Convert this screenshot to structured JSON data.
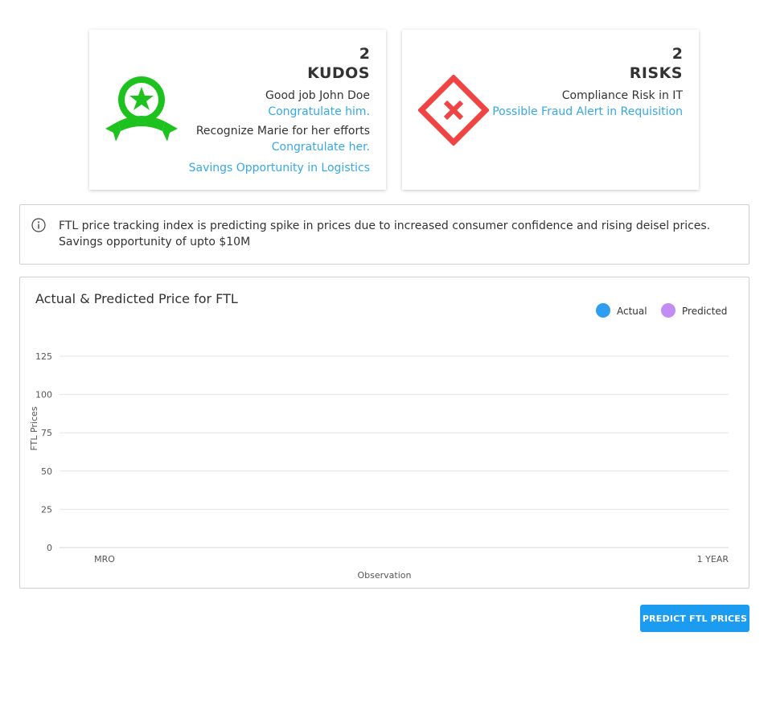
{
  "kudos": {
    "count": "2",
    "title": "KUDOS",
    "icon": "ribbon-star-icon",
    "items": [
      {
        "text": "Good job John Doe",
        "link": "Congratulate him."
      },
      {
        "text": "Recognize Marie for her efforts",
        "link": "Congratulate her."
      }
    ],
    "footer_link": "Savings Opportunity in Logistics"
  },
  "risks": {
    "count": "2",
    "title": "RISKS",
    "icon": "diamond-x-icon",
    "items": [
      {
        "text": "Compliance Risk in IT"
      },
      {
        "link": "Possible Fraud Alert in Requisition"
      }
    ]
  },
  "info": {
    "icon": "info-icon",
    "text_line1": "FTL price tracking index is predicting spike in prices due to increased consumer confidence and rising deisel prices.",
    "text_line2": "Savings opportunity of upto $10M"
  },
  "chart_data": {
    "type": "line",
    "title": "Actual & Predicted Price for FTL",
    "xlabel": "Observation",
    "ylabel": "FTL Prices",
    "categories": [
      "MRO",
      "1 YEAR"
    ],
    "y_ticks": [
      "125",
      "100",
      "75",
      "50",
      "25",
      "0"
    ],
    "ylim": [
      0,
      125
    ],
    "grid": true,
    "legend_position": "top-right",
    "series": [
      {
        "name": "Actual",
        "color": "#2f9df0",
        "values": []
      },
      {
        "name": "Predicted",
        "color": "#c38cf2",
        "values": []
      }
    ]
  },
  "colors": {
    "kudos_green": "#1ec21e",
    "risk_red": "#f04343",
    "link_blue": "#35a9e6",
    "button_blue": "#1c9cf0"
  },
  "actions": {
    "predict_label": "PREDICT FTL PRICES"
  }
}
